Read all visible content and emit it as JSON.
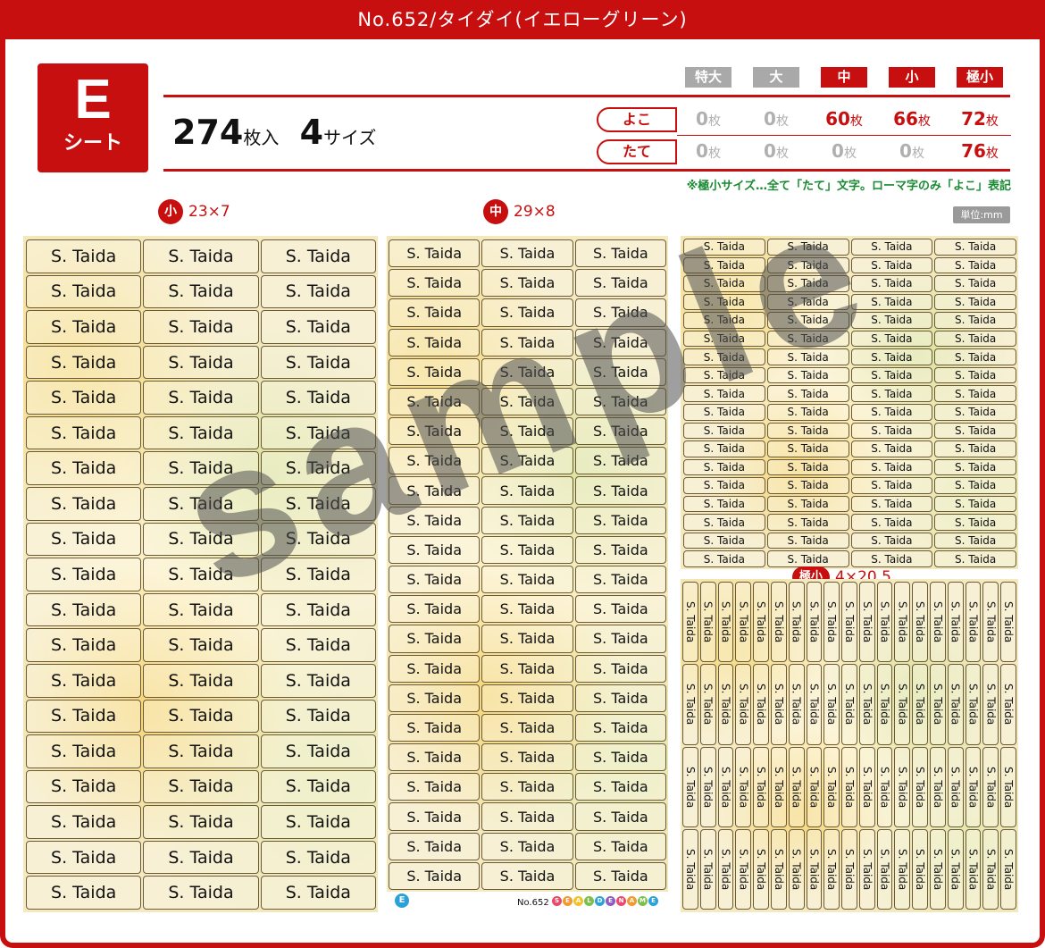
{
  "header": {
    "title": "No.652/タイダイ(イエローグリーン)"
  },
  "sheet": {
    "letter": "E",
    "label": "シート"
  },
  "summary": {
    "count": "274",
    "count_unit": "枚入",
    "sizes": "4",
    "sizes_unit": "サイズ"
  },
  "size_headers": [
    "特大",
    "大",
    "中",
    "小",
    "極小"
  ],
  "size_header_colors": [
    "#a9a9a9",
    "#a9a9a9",
    "#c80f0f",
    "#c80f0f",
    "#c80f0f"
  ],
  "rows": [
    {
      "label": "よこ",
      "values": [
        "0",
        "0",
        "60",
        "66",
        "72"
      ]
    },
    {
      "label": "たて",
      "values": [
        "0",
        "0",
        "0",
        "0",
        "76"
      ]
    }
  ],
  "count_unit_small": "枚",
  "note": "※極小サイズ…全て「たて」文字。ローマ字のみ「よこ」表記",
  "sections": {
    "small": {
      "badge": "小",
      "dims": "23×7"
    },
    "medium": {
      "badge": "中",
      "dims": "29×8"
    },
    "tiny": {
      "badge": "極小",
      "dims": "4×20.5"
    }
  },
  "unit_label": "単位:mm",
  "label_text": "S. Taida",
  "watermark": "sample",
  "footer": {
    "badge": "E",
    "number": "No.652",
    "brand": "SEALDENAME"
  },
  "colors": {
    "accent": "#c80f0f",
    "note": "#1a8a33",
    "badge_blue": "#2aa2d8"
  }
}
